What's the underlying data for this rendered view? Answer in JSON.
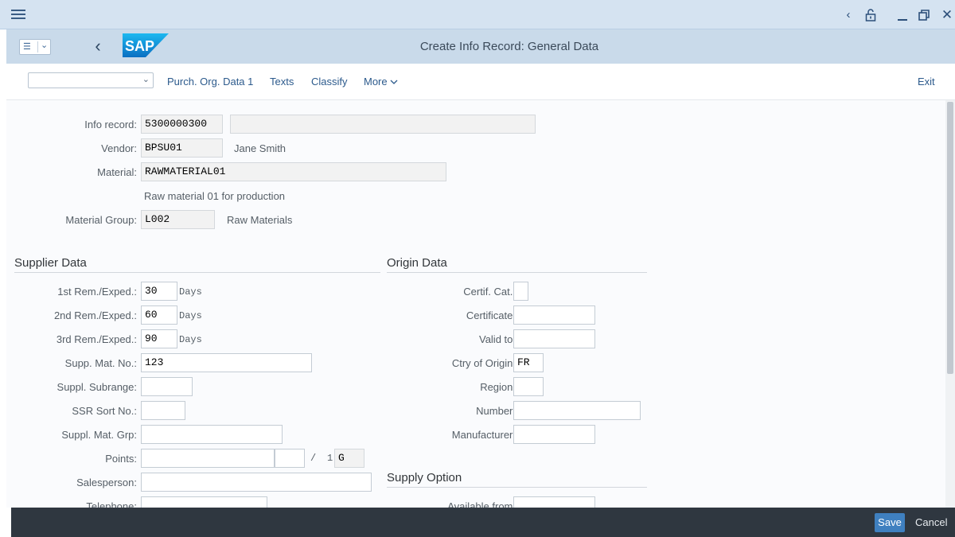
{
  "shell": {
    "title": "Create Info Record: General Data",
    "logo_text": "SAP"
  },
  "toolbar": {
    "dropdown_value": "",
    "buttons": [
      "Purch. Org. Data 1",
      "Texts",
      "Classify",
      "More"
    ],
    "exit": "Exit"
  },
  "header": {
    "info_record_label": "Info record:",
    "info_record_value": "5300000300",
    "info_record_desc": "",
    "vendor_label": "Vendor:",
    "vendor_value": "BPSU01",
    "vendor_name": "Jane Smith",
    "material_label": "Material:",
    "material_value": "RAWMATERIAL01",
    "material_desc": "Raw material 01 for production",
    "matgroup_label": "Material Group:",
    "matgroup_value": "L002",
    "matgroup_desc": "Raw Materials"
  },
  "supplier": {
    "title": "Supplier Data",
    "rem1_label": "1st Rem./Exped.:",
    "rem1_value": "30",
    "rem2_label": "2nd Rem./Exped.:",
    "rem2_value": "60",
    "rem3_label": "3rd Rem./Exped.:",
    "rem3_value": "90",
    "days_unit": "Days",
    "supp_mat_label": "Supp. Mat. No.:",
    "supp_mat_value": "123",
    "subrange_label": "Suppl. Subrange:",
    "subrange_value": "",
    "ssr_label": "SSR Sort No.:",
    "ssr_value": "",
    "mat_grp_label": "Suppl. Mat. Grp:",
    "mat_grp_value": "",
    "points_label": "Points:",
    "points_value": "",
    "points_unit_value": "",
    "points_per": "/",
    "points_per_value": "1",
    "points_uom": "G",
    "salesperson_label": "Salesperson:",
    "salesperson_value": "",
    "telephone_label": "Telephone:",
    "telephone_value": ""
  },
  "origin": {
    "title": "Origin Data",
    "certcat_label": "Certif. Cat.:",
    "certcat_value": "",
    "certificate_label": "Certificate:",
    "certificate_value": "",
    "valid_label": "Valid to:",
    "valid_value": "",
    "ctry_label": "Ctry of Origin:",
    "ctry_value": "FR",
    "region_label": "Region:",
    "region_value": "",
    "number_label": "Number:",
    "number_value": "",
    "manufacturer_label": "Manufacturer:",
    "manufacturer_value": ""
  },
  "supply": {
    "title": "Supply Option",
    "avail_label": "Available from:",
    "avail_value": ""
  },
  "footer": {
    "save": "Save",
    "cancel": "Cancel"
  }
}
